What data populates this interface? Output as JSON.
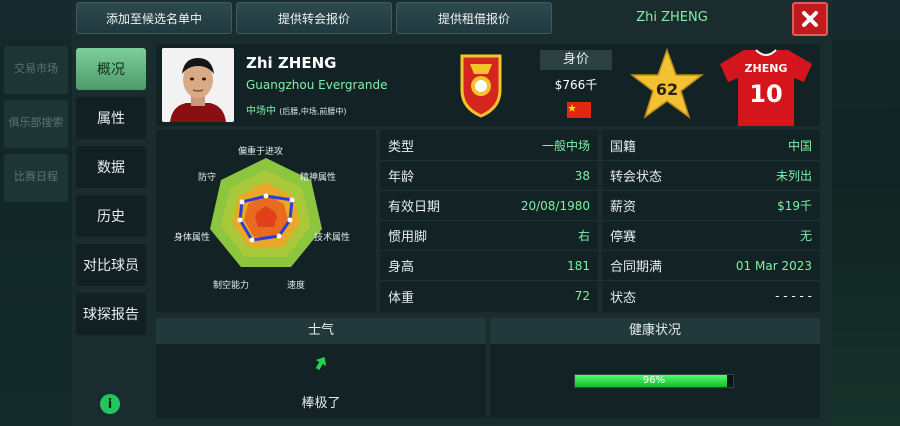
{
  "background": {
    "left_items": [
      "交易市场",
      "俱乐部搜索",
      "比赛日程"
    ]
  },
  "top_buttons": {
    "shortlist": "添加至候选名单中",
    "transfer_offer": "提供转会报价",
    "loan_offer": "提供租借报价"
  },
  "title": "Zhi ZHENG",
  "nav": {
    "overview": "概况",
    "attributes": "属性",
    "data": "数据",
    "history": "历史",
    "compare": "对比球员",
    "scout_report": "球探报告"
  },
  "player": {
    "name": "Zhi ZHENG",
    "club": "Guangzhou Evergrande",
    "position": "中场中",
    "position_detail": "(后腰,中场,前腰中)",
    "value_label": "身价",
    "value": "$766千",
    "rating": "62",
    "shirt_name": "ZHENG",
    "shirt_number": "10"
  },
  "radar": {
    "labels": {
      "attack": "偏重于进攻",
      "mental": "精神属性",
      "technical": "技术属性",
      "speed": "速度",
      "aerial": "制空能力",
      "physical": "身体属性",
      "defense": "防守"
    }
  },
  "stats_left": [
    {
      "label": "类型",
      "value": "一般中场"
    },
    {
      "label": "年龄",
      "value": "38"
    },
    {
      "label": "有效日期",
      "value": "20/08/1980"
    },
    {
      "label": "惯用脚",
      "value": "右"
    },
    {
      "label": "身高",
      "value": "181"
    },
    {
      "label": "体重",
      "value": "72"
    }
  ],
  "stats_right": [
    {
      "label": "国籍",
      "value": "中国"
    },
    {
      "label": "转会状态",
      "value": "未列出"
    },
    {
      "label": "薪资",
      "value": "$19千"
    },
    {
      "label": "停赛",
      "value": "无"
    },
    {
      "label": "合同期满",
      "value": "01 Mar 2023"
    },
    {
      "label": "状态",
      "value": "- - - - -"
    }
  ],
  "morale": {
    "title": "士气",
    "value": "棒极了"
  },
  "health": {
    "title": "健康状况",
    "percent_text": "96%",
    "percent": 96
  },
  "colors": {
    "accent_green": "#7ff0a8",
    "close_red": "#c0191e",
    "shirt_red": "#d4161c",
    "star_gold": "#f3c234"
  }
}
